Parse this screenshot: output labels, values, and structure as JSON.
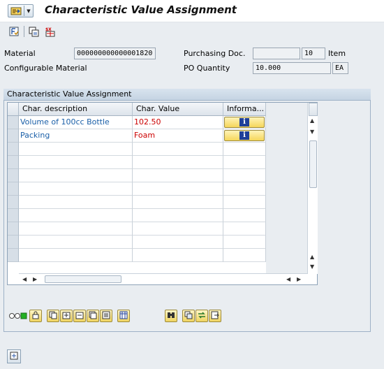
{
  "window": {
    "title": "Characteristic Value Assignment"
  },
  "header": {
    "material_label": "Material",
    "material_value": "000000000000001820",
    "configurable_label": "Configurable Material",
    "purchasing_doc_label": "Purchasing Doc.",
    "purchasing_doc_value": "",
    "item_value": "10",
    "item_label": "Item",
    "po_qty_label": "PO Quantity",
    "po_qty_value": "10.000",
    "po_qty_unit": "EA"
  },
  "group": {
    "title": "Characteristic Value Assignment"
  },
  "table": {
    "columns": [
      "Char. description",
      "Char. Value",
      "Informa..."
    ],
    "rows": [
      {
        "description": "Volume of 100cc Bottle",
        "value": "102.50"
      },
      {
        "description": "Packing",
        "value": "Foam"
      }
    ]
  },
  "colors": {
    "description_text": "#1a5fa8",
    "value_text": "#cc0000",
    "accent": "#1f3f99"
  }
}
